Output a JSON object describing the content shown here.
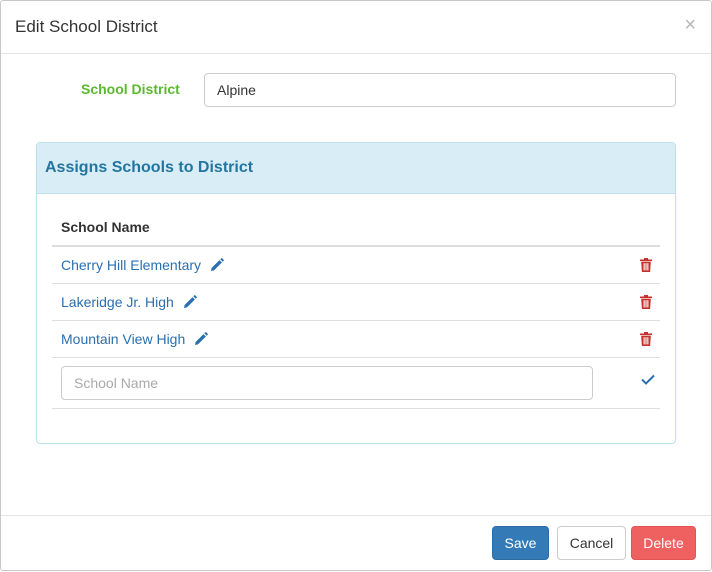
{
  "modal": {
    "title": "Edit School District",
    "close_glyph": "×"
  },
  "district": {
    "label": "School District",
    "value": "Alpine"
  },
  "panel": {
    "title": "Assigns Schools to District",
    "column_header": "School Name",
    "schools": [
      {
        "name": "Cherry Hill Elementary",
        "icon": "pencil-icon",
        "action_icon": "trash-icon"
      },
      {
        "name": "Lakeridge Jr. High",
        "icon": "pencil-icon",
        "action_icon": "trash-icon"
      },
      {
        "name": "Mountain View High",
        "icon": "pencil-icon",
        "action_icon": "trash-icon"
      }
    ],
    "new_school_placeholder": "School Name",
    "new_school_value": ""
  },
  "footer": {
    "save_label": "Save",
    "cancel_label": "Cancel",
    "delete_label": "Delete"
  },
  "colors": {
    "label_green": "#5cb82f",
    "link_blue": "#2a6fb0",
    "panel_heading_bg": "#d9edf7",
    "panel_title": "#23759f",
    "trash_red": "#c9302c",
    "save_bg": "#337ab7",
    "delete_bg": "#ef6161"
  }
}
